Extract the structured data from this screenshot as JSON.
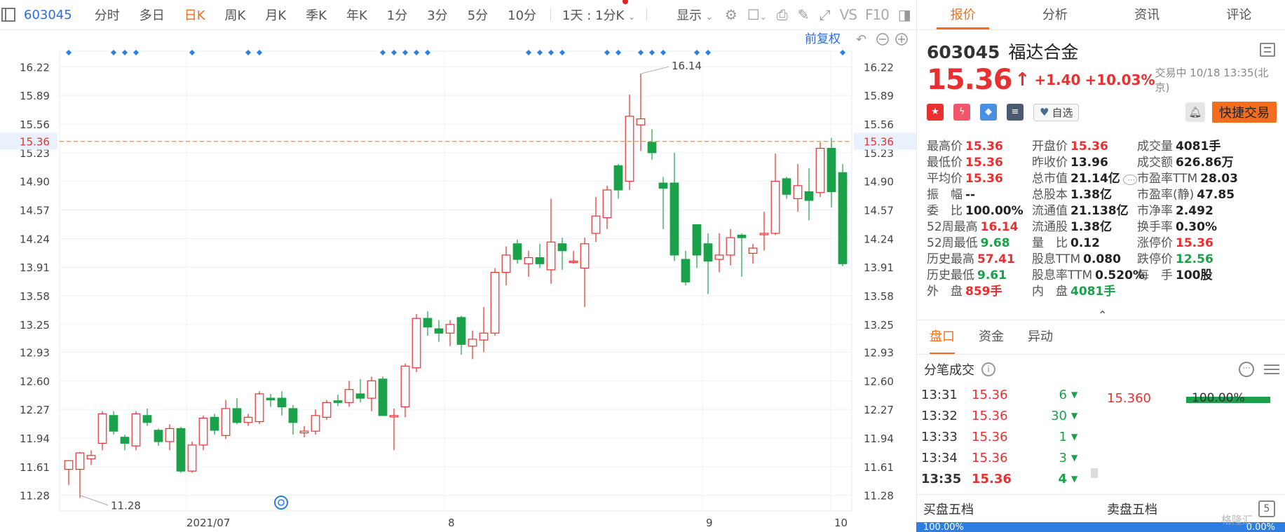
{
  "toolbar": {
    "code": "603045",
    "periods": [
      "分时",
      "多日",
      "日K",
      "周K",
      "月K",
      "季K",
      "年K",
      "1分",
      "3分",
      "5分",
      "10分"
    ],
    "active_period": "日K",
    "interval_dropdown": "1天 : 1分K",
    "display_dropdown": "显示",
    "icons": [
      "settings-icon",
      "box-icon",
      "camera-icon",
      "pencil-icon",
      "fullscreen-icon"
    ],
    "vs_label": "VS",
    "f10_label": "F10",
    "restore_label": "前复权"
  },
  "chart_data": {
    "type": "candlestick",
    "ytick_labels": [
      "16.22",
      "15.89",
      "15.56",
      "15.23",
      "14.90",
      "14.57",
      "14.24",
      "13.91",
      "13.58",
      "13.25",
      "12.93",
      "12.60",
      "12.27",
      "11.94",
      "11.61",
      "11.28"
    ],
    "ylim": [
      11.1,
      16.4
    ],
    "x_labels": [
      "2021/07",
      "8",
      "9",
      "10"
    ],
    "current_price_label": "15.36",
    "current_price": 15.36,
    "max_annotation": "16.14",
    "max_value": 16.14,
    "min_annotation": "11.28",
    "min_value": 11.28,
    "candles": [
      [
        11.58,
        11.68,
        11.58,
        11.4
      ],
      [
        11.58,
        11.77,
        11.78,
        11.25
      ],
      [
        11.7,
        11.74,
        11.8,
        11.63
      ],
      [
        11.88,
        12.22,
        12.25,
        11.8
      ],
      [
        12.2,
        12.02,
        12.25,
        11.98
      ],
      [
        11.95,
        11.88,
        11.98,
        11.8
      ],
      [
        11.85,
        12.22,
        12.25,
        11.8
      ],
      [
        12.2,
        12.12,
        12.28,
        12.08
      ],
      [
        12.03,
        11.9,
        12.05,
        11.85
      ],
      [
        11.9,
        12.05,
        12.1,
        11.8
      ],
      [
        12.05,
        11.56,
        12.07,
        11.54
      ],
      [
        11.56,
        11.86,
        11.9,
        11.54
      ],
      [
        11.86,
        12.17,
        12.2,
        11.8
      ],
      [
        12.18,
        12.03,
        12.22,
        11.98
      ],
      [
        11.97,
        12.28,
        12.38,
        11.93
      ],
      [
        12.28,
        12.12,
        12.4,
        12.1
      ],
      [
        12.12,
        12.18,
        12.22,
        12.08
      ],
      [
        12.13,
        12.45,
        12.48,
        12.1
      ],
      [
        12.4,
        12.38,
        12.45,
        12.3
      ],
      [
        12.4,
        12.3,
        12.48,
        12.2
      ],
      [
        12.28,
        12.12,
        12.32,
        11.98
      ],
      [
        12.0,
        12.02,
        12.08,
        11.95
      ],
      [
        12.02,
        12.2,
        12.27,
        11.98
      ],
      [
        12.18,
        12.35,
        12.38,
        12.15
      ],
      [
        12.37,
        12.35,
        12.44,
        12.31
      ],
      [
        12.35,
        12.5,
        12.6,
        12.3
      ],
      [
        12.45,
        12.4,
        12.62,
        12.35
      ],
      [
        12.4,
        12.6,
        12.65,
        12.25
      ],
      [
        12.62,
        12.2,
        12.65,
        12.2
      ],
      [
        12.2,
        12.2,
        12.28,
        11.8
      ],
      [
        12.3,
        12.77,
        12.8,
        12.18
      ],
      [
        12.75,
        13.32,
        13.37,
        12.7
      ],
      [
        13.32,
        13.22,
        13.4,
        13.12
      ],
      [
        13.2,
        13.15,
        13.3,
        13.05
      ],
      [
        13.15,
        13.25,
        13.3,
        13.0
      ],
      [
        13.33,
        13.02,
        13.35,
        12.9
      ],
      [
        13.0,
        13.08,
        13.18,
        12.85
      ],
      [
        13.07,
        13.15,
        13.45,
        12.93
      ],
      [
        13.15,
        13.85,
        13.9,
        13.12
      ],
      [
        13.85,
        14.05,
        14.15,
        13.7
      ],
      [
        14.18,
        14.0,
        14.23,
        13.95
      ],
      [
        13.95,
        14.02,
        14.1,
        13.8
      ],
      [
        14.02,
        13.95,
        14.18,
        13.9
      ],
      [
        13.88,
        14.2,
        14.7,
        13.72
      ],
      [
        14.18,
        14.1,
        14.25,
        13.88
      ],
      [
        13.97,
        13.98,
        14.1,
        13.95
      ],
      [
        13.9,
        14.18,
        14.25,
        13.45
      ],
      [
        14.3,
        14.5,
        14.72,
        14.2
      ],
      [
        14.48,
        14.8,
        14.85,
        14.35
      ],
      [
        15.08,
        14.8,
        15.1,
        14.7
      ],
      [
        14.9,
        15.65,
        15.9,
        14.8
      ],
      [
        15.55,
        15.62,
        16.14,
        15.25
      ],
      [
        15.35,
        15.23,
        15.5,
        15.15
      ],
      [
        14.88,
        14.82,
        14.95,
        14.35
      ],
      [
        14.88,
        14.05,
        15.23,
        13.98
      ],
      [
        14.0,
        13.74,
        14.1,
        13.7
      ],
      [
        14.4,
        14.05,
        14.4,
        13.9
      ],
      [
        14.18,
        13.98,
        14.3,
        13.6
      ],
      [
        14.0,
        14.05,
        14.3,
        13.85
      ],
      [
        14.05,
        14.25,
        14.35,
        13.93
      ],
      [
        14.28,
        14.25,
        14.3,
        13.8
      ],
      [
        14.07,
        14.13,
        14.18,
        13.95
      ],
      [
        14.3,
        14.3,
        14.55,
        14.1
      ],
      [
        14.3,
        14.9,
        15.22,
        14.28
      ],
      [
        14.93,
        14.75,
        14.95,
        14.7
      ],
      [
        14.7,
        14.85,
        15.1,
        14.55
      ],
      [
        14.78,
        14.68,
        15.05,
        14.45
      ],
      [
        14.77,
        15.28,
        15.35,
        14.72
      ],
      [
        15.28,
        14.78,
        15.4,
        14.6
      ],
      [
        15.0,
        13.95,
        15.1,
        13.92
      ]
    ],
    "candle_fields": [
      "open",
      "close",
      "high",
      "low"
    ],
    "info_markers": [
      0,
      4,
      5,
      6,
      11,
      16,
      17,
      28,
      29,
      30,
      31,
      32,
      41,
      42,
      43,
      44,
      48,
      49,
      51,
      52,
      53,
      56,
      57,
      69
    ],
    "colors": {
      "up": "#e93030",
      "down": "#1aa14a",
      "marker": "#2b7de9",
      "price_line": "#f2902c",
      "axis_text": "#444",
      "grid": "#eef1f5"
    }
  },
  "quote": {
    "code": "603045",
    "name": "福达合金",
    "price": "15.36",
    "change": "+1.40",
    "change_pct": "+10.03%",
    "status": "交易中 10/18 13:35(北京)",
    "fav_label": "自选",
    "fast_trade_label": "快捷交易",
    "badges": [
      {
        "name": "china-flag-icon",
        "color": "#e93030",
        "glyph": "★"
      },
      {
        "name": "lightning-icon",
        "color": "#f2566a",
        "glyph": "ϟ"
      },
      {
        "name": "tag-icon",
        "color": "#4a90e2",
        "glyph": "◆"
      },
      {
        "name": "document-icon",
        "color": "#4a5a70",
        "glyph": "≡"
      }
    ]
  },
  "tabs": [
    "报价",
    "分析",
    "资讯",
    "评论"
  ],
  "active_tab": "报价",
  "stats": [
    [
      {
        "label": "最高价",
        "value": "15.36",
        "color": "red"
      },
      {
        "label": "最低价",
        "value": "15.36",
        "color": "red"
      },
      {
        "label": "平均价",
        "value": "15.36",
        "color": "red"
      },
      {
        "label": "振　幅",
        "value": "--",
        "color": ""
      },
      {
        "label": "委　比",
        "value": "100.00%",
        "color": ""
      },
      {
        "label": "52周最高",
        "value": "16.14",
        "color": "red"
      },
      {
        "label": "52周最低",
        "value": "9.68",
        "color": "green"
      },
      {
        "label": "历史最高",
        "value": "57.41",
        "color": "red"
      },
      {
        "label": "历史最低",
        "value": "9.61",
        "color": "green"
      },
      {
        "label": "外　盘",
        "value": "859手",
        "color": "red"
      }
    ],
    [
      {
        "label": "开盘价",
        "value": "15.36",
        "color": "red"
      },
      {
        "label": "昨收价",
        "value": "13.96",
        "color": ""
      },
      {
        "label": "总市值",
        "value": "21.14亿",
        "color": ""
      },
      {
        "label": "总股本",
        "value": "1.38亿",
        "color": ""
      },
      {
        "label": "流通值",
        "value": "21.138亿",
        "color": ""
      },
      {
        "label": "流通股",
        "value": "1.38亿",
        "color": ""
      },
      {
        "label": "量　比",
        "value": "0.12",
        "color": ""
      },
      {
        "label": "股息TTM",
        "value": "0.080",
        "color": ""
      },
      {
        "label": "股息率TTM",
        "value": "0.520%",
        "color": ""
      },
      {
        "label": "内　盘",
        "value": "4081手",
        "color": "green"
      }
    ],
    [
      {
        "label": "成交量",
        "value": "4081手",
        "color": ""
      },
      {
        "label": "成交额",
        "value": "626.86万",
        "color": ""
      },
      {
        "label": "市盈率TTM",
        "value": "28.03",
        "color": ""
      },
      {
        "label": "市盈率(静)",
        "value": "47.85",
        "color": ""
      },
      {
        "label": "市净率",
        "value": "2.492",
        "color": ""
      },
      {
        "label": "换手率",
        "value": "0.30%",
        "color": ""
      },
      {
        "label": "涨停价",
        "value": "15.36",
        "color": "red"
      },
      {
        "label": "跌停价",
        "value": "12.56",
        "color": "green"
      },
      {
        "label": "每　手",
        "value": "100股",
        "color": ""
      }
    ]
  ],
  "subtabs": [
    "盘口",
    "资金",
    "异动"
  ],
  "active_subtab": "盘口",
  "ticks": {
    "title": "分笔成交",
    "rows": [
      {
        "time": "13:31",
        "price": "15.36",
        "vol": "6"
      },
      {
        "time": "13:32",
        "price": "15.36",
        "vol": "30"
      },
      {
        "time": "13:33",
        "price": "15.36",
        "vol": "1"
      },
      {
        "time": "13:34",
        "price": "15.36",
        "vol": "3"
      },
      {
        "time": "13:35",
        "price": "15.36",
        "vol": "4"
      }
    ],
    "dist_price": "15.360",
    "dist_pct": "100.00%"
  },
  "book": {
    "buy_label": "买盘五档",
    "sell_label": "卖盘五档",
    "buy_pct": "100.00%",
    "sell_pct": "0.00%",
    "five_icon_label": "5"
  },
  "watermark": "格隆汇"
}
